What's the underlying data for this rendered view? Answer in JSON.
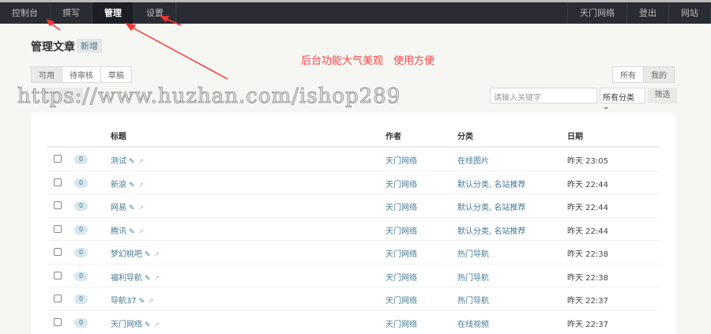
{
  "nav": {
    "left": [
      "控制台",
      "撰写",
      "管理",
      "设置"
    ],
    "active": 2,
    "right": [
      "天门网络",
      "登出",
      "网站"
    ]
  },
  "page_title": "管理文章",
  "add_label": "新增",
  "promo": "后台功能大气美观　使用方便",
  "status_tabs": [
    "可用",
    "待审核",
    "草稿"
  ],
  "scope_tabs": [
    "所有",
    "我的"
  ],
  "watermark": "https://www.huzhan.com/ishop289",
  "search": {
    "placeholder": "请输入关键字"
  },
  "category_select": "所有分类",
  "filter_label": "筛选",
  "columns": {
    "title": "标题",
    "author": "作者",
    "category": "分类",
    "date": "日期"
  },
  "rows": [
    {
      "comments": "0",
      "title": "测试",
      "author": "天门网络",
      "category": "在线图片",
      "date": "昨天 23:05"
    },
    {
      "comments": "0",
      "title": "新浪",
      "author": "天门网络",
      "category": "默认分类, 名站推荐",
      "date": "昨天 22:44"
    },
    {
      "comments": "0",
      "title": "网易",
      "author": "天门网络",
      "category": "默认分类, 名站推荐",
      "date": "昨天 22:44"
    },
    {
      "comments": "0",
      "title": "腾讯",
      "author": "天门网络",
      "category": "默认分类, 名站推荐",
      "date": "昨天 22:44"
    },
    {
      "comments": "0",
      "title": "梦幻桃吧",
      "author": "天门网络",
      "category": "热门导航",
      "date": "昨天 22:38"
    },
    {
      "comments": "0",
      "title": "福利导航",
      "author": "天门网络",
      "category": "热门导航",
      "date": "昨天 22:38"
    },
    {
      "comments": "0",
      "title": "导航37",
      "author": "天门网络",
      "category": "热门导航",
      "date": "昨天 22:37"
    },
    {
      "comments": "0",
      "title": "天门网络",
      "author": "天门网络",
      "category": "在线视频",
      "date": "昨天 22:37"
    }
  ]
}
